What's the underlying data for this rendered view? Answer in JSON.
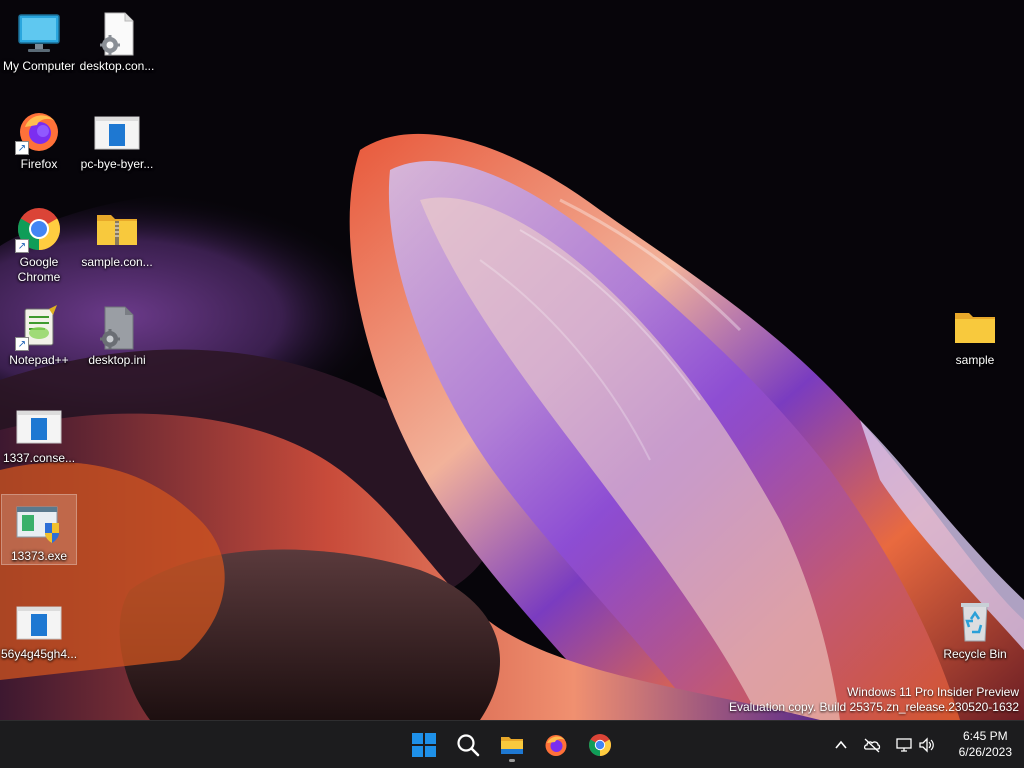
{
  "desktop": {
    "icons": {
      "my_computer": "My Computer",
      "desktop_config": "desktop.con...",
      "firefox": "Firefox",
      "pc_bye": "pc-bye-byer...",
      "google_chrome": "Google Chrome",
      "sample_zip": "sample.con...",
      "notepadpp": "Notepad++",
      "desktop_ini": "desktop.ini",
      "consent_1337": "1337.conse...",
      "exe_13373": "13373.exe",
      "file_56y": "56y4g45gh4...",
      "sample_folder": "sample",
      "recycle_bin": "Recycle Bin"
    },
    "selected_icon": "13373.exe"
  },
  "watermark": {
    "line1": "Windows 11 Pro Insider Preview",
    "line2": "Evaluation copy. Build 25375.zn_release.230520-1632"
  },
  "taskbar": {
    "pinned": [
      "start-icon",
      "search-icon",
      "file-explorer-icon",
      "firefox-icon",
      "chrome-icon"
    ],
    "tray_icons": [
      "chevron-up-icon",
      "onedrive-offline-icon",
      "network-icon",
      "volume-icon"
    ],
    "time": "6:45 PM",
    "date": "6/26/2023"
  },
  "colors": {
    "taskbar_bg": "#1c1c1e",
    "folder_yellow": "#f8c93d",
    "windows_blue": "#1e90e8"
  }
}
